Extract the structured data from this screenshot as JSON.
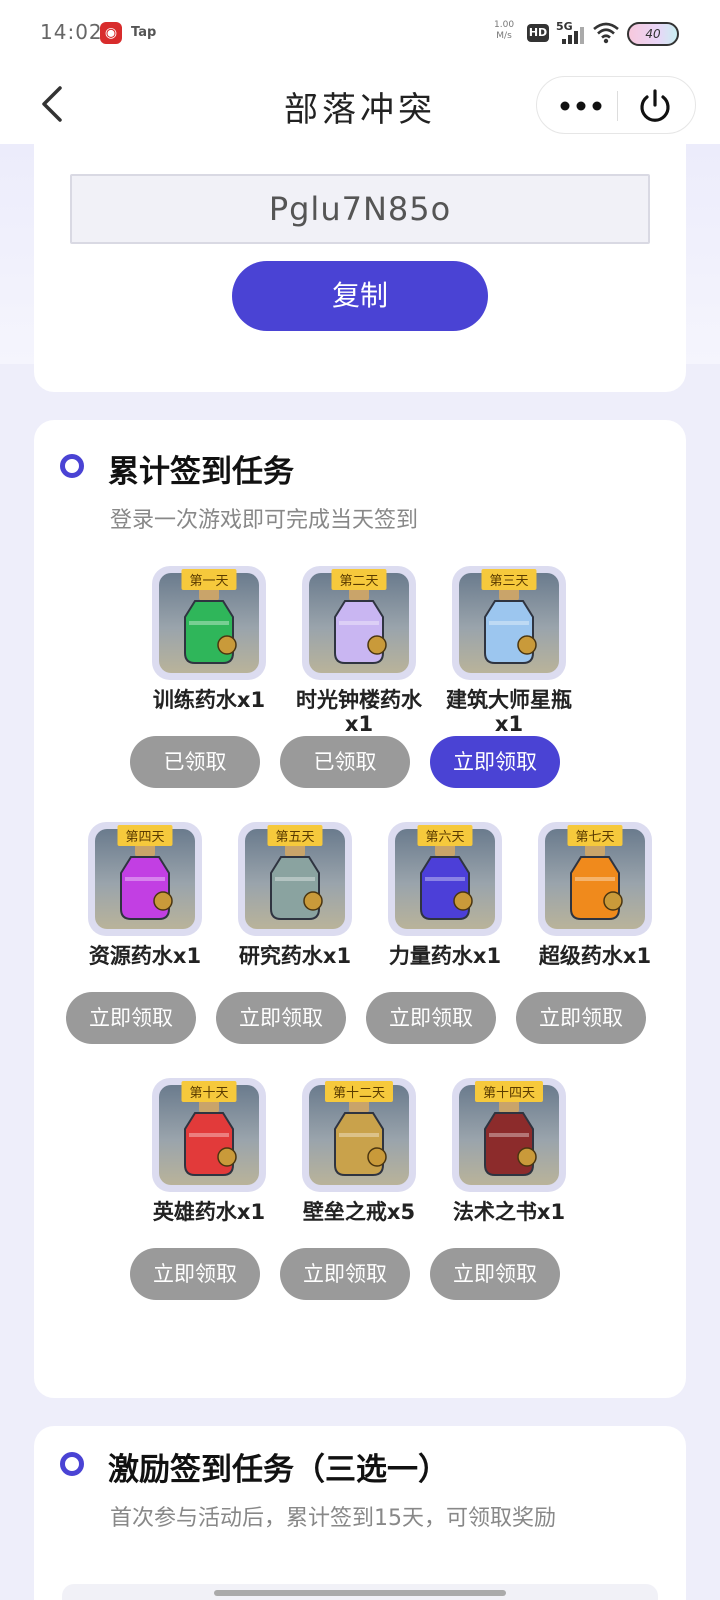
{
  "status_bar": {
    "time": "14:02",
    "app1_icon": "netease-music-icon",
    "app2_label": "Tap",
    "net_speed_value": "1.00",
    "net_speed_unit": "M/s",
    "hd_label": "HD",
    "signal_label": "5G",
    "battery": "40"
  },
  "nav": {
    "title": "部落冲突",
    "back_icon": "chevron-left-icon",
    "more_icon": "more-dots-icon",
    "power_icon": "power-icon"
  },
  "code_card": {
    "code": "Pglu7N85o",
    "copy_label": "复制"
  },
  "signin_task": {
    "title": "累计签到任务",
    "subtitle": "登录一次游戏即可完成当天签到",
    "items": [
      {
        "day": "第一天",
        "name": "训练药水x1",
        "button": "已领取",
        "state": "claimed",
        "potion_color": "#2fb65a"
      },
      {
        "day": "第二天",
        "name": "时光钟楼药水x1",
        "button": "已领取",
        "state": "claimed",
        "potion_color": "#c9b6f2"
      },
      {
        "day": "第三天",
        "name": "建筑大师星瓶x1",
        "button": "立即领取",
        "state": "active",
        "potion_color": "#9cc6ef"
      },
      {
        "day": "第四天",
        "name": "资源药水x1",
        "button": "立即领取",
        "state": "locked",
        "potion_color": "#c23fe3"
      },
      {
        "day": "第五天",
        "name": "研究药水x1",
        "button": "立即领取",
        "state": "locked",
        "potion_color": "#8aa3a0"
      },
      {
        "day": "第六天",
        "name": "力量药水x1",
        "button": "立即领取",
        "state": "locked",
        "potion_color": "#4c3fd8"
      },
      {
        "day": "第七天",
        "name": "超级药水x1",
        "button": "立即领取",
        "state": "locked",
        "potion_color": "#f08a1c"
      },
      {
        "day": "第十天",
        "name": "英雄药水x1",
        "button": "立即领取",
        "state": "locked",
        "potion_color": "#e23a3a"
      },
      {
        "day": "第十二天",
        "name": "壁垒之戒x5",
        "button": "立即领取",
        "state": "locked",
        "potion_color": "#c9a24b"
      },
      {
        "day": "第十四天",
        "name": "法术之书x1",
        "button": "立即领取",
        "state": "locked",
        "potion_color": "#8c2b2b"
      }
    ]
  },
  "incentive_task": {
    "title": "激励签到任务（三选一）",
    "subtitle": "首次参与活动后，累计签到15天，可领取奖励"
  },
  "colors": {
    "accent": "#4a43d4",
    "disabled": "#9a9a9a",
    "day_tag": "#f6c93c"
  }
}
